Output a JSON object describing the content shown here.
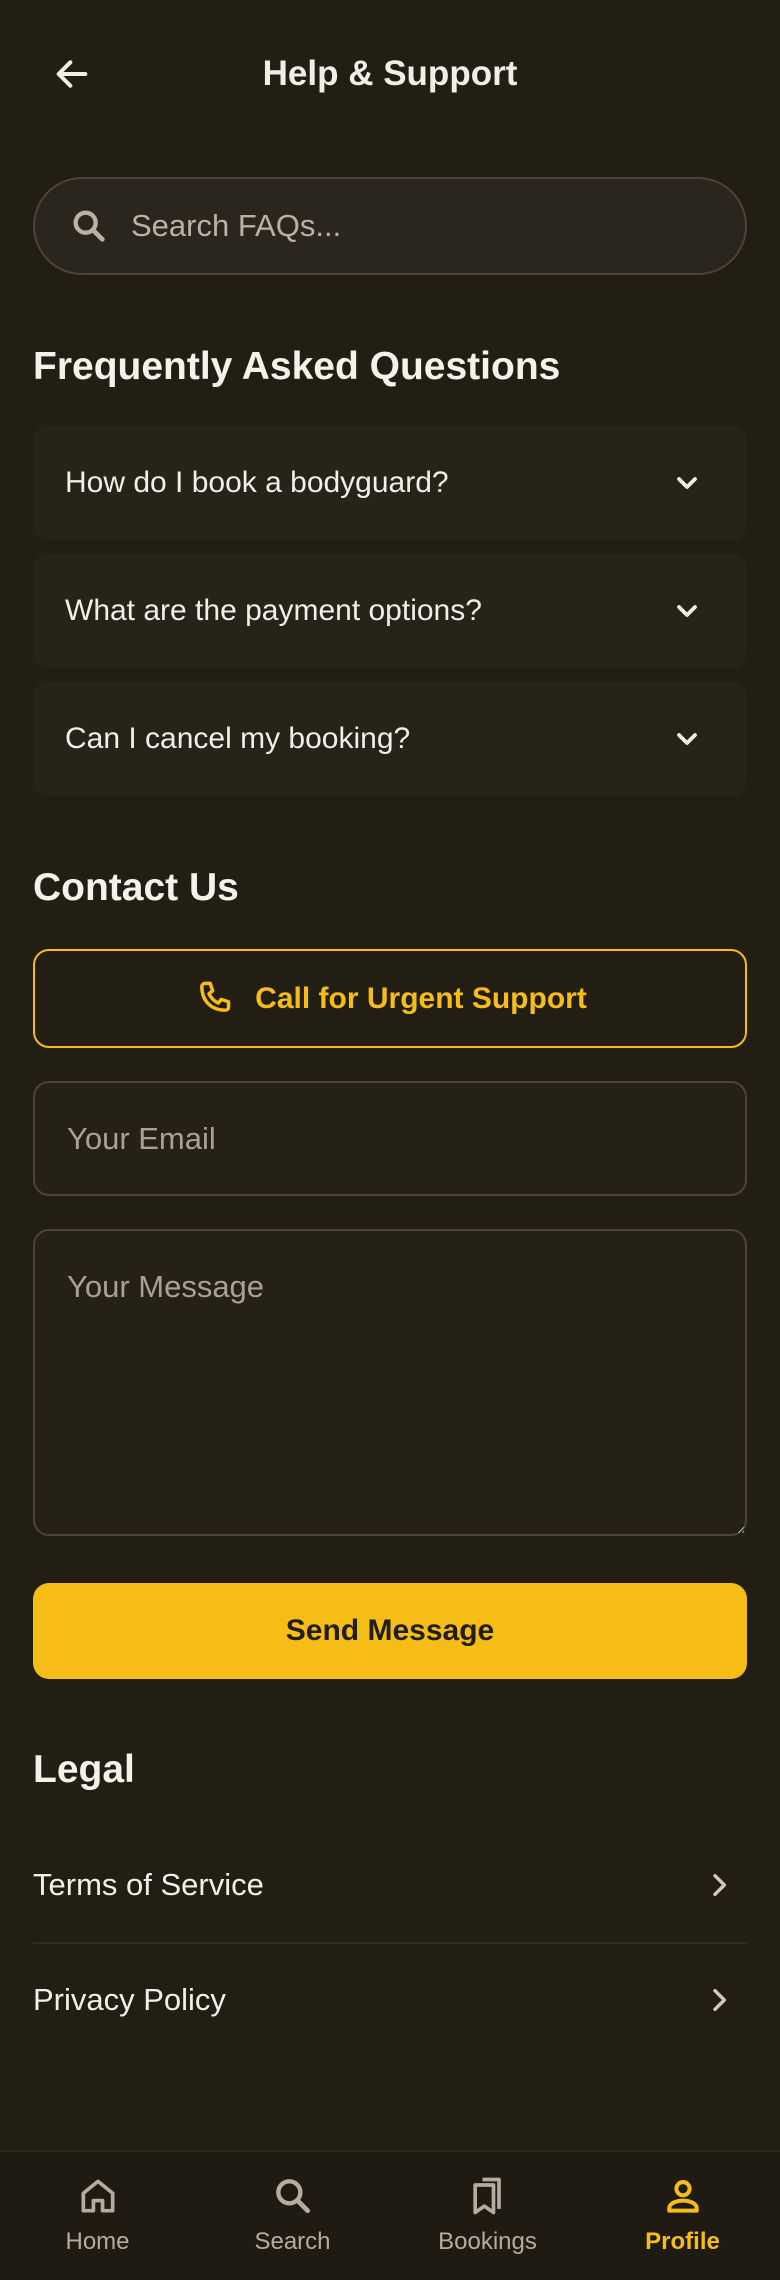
{
  "header": {
    "title": "Help & Support",
    "back_icon": "arrow-left-icon"
  },
  "search": {
    "placeholder": "Search FAQs...",
    "value": "",
    "icon": "search-icon"
  },
  "faq": {
    "title": "Frequently Asked Questions",
    "items": [
      {
        "question": "How do I book a bodyguard?",
        "icon": "chevron-down-icon"
      },
      {
        "question": "What are the payment options?",
        "icon": "chevron-down-icon"
      },
      {
        "question": "Can I cancel my booking?",
        "icon": "chevron-down-icon"
      }
    ]
  },
  "contact": {
    "title": "Contact Us",
    "urgent_label": "Call for Urgent Support",
    "urgent_icon": "phone-icon",
    "email_placeholder": "Your Email",
    "email_value": "",
    "message_placeholder": "Your Message",
    "message_value": "",
    "send_label": "Send Message"
  },
  "legal": {
    "title": "Legal",
    "items": [
      {
        "label": "Terms of Service",
        "icon": "chevron-right-icon"
      },
      {
        "label": "Privacy Policy",
        "icon": "chevron-right-icon"
      }
    ]
  },
  "nav": {
    "items": [
      {
        "label": "Home",
        "icon": "home-icon",
        "active": false
      },
      {
        "label": "Search",
        "icon": "search-icon",
        "active": false
      },
      {
        "label": "Bookings",
        "icon": "bookmarks-icon",
        "active": false
      },
      {
        "label": "Profile",
        "icon": "person-icon",
        "active": true
      }
    ]
  },
  "colors": {
    "background": "#221e14",
    "accent": "#f5bd15",
    "text": "#f2efe8",
    "muted": "#b3ad9f",
    "card": "#272319",
    "border": "#4a4538"
  }
}
